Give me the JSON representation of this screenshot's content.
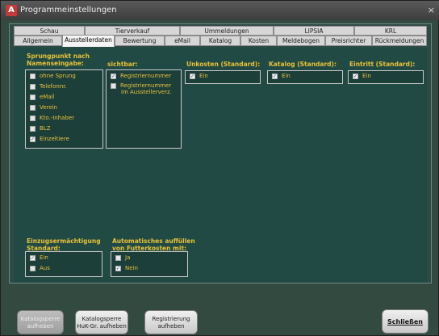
{
  "window": {
    "title": "Programmeinstellungen",
    "app_icon": "A",
    "close_glyph": "×"
  },
  "tabs_row1": [
    "Schau",
    "Tierverkauf",
    "Ummeldungen",
    "LIPSIA",
    "KRL"
  ],
  "tabs_row2": [
    "Allgemein",
    "Ausstellerdaten",
    "Bewertung",
    "eMail",
    "Katalog",
    "Kosten",
    "Meldebogen",
    "Preisrichter",
    "Rückmeldungen"
  ],
  "active_tab": "Ausstellerdaten",
  "sections": {
    "sprungpunkt": {
      "title_line1": "Sprungpunkt nach",
      "title_line2": "Namenseingabe:",
      "options": [
        {
          "label": "ohne Sprung",
          "checked": false
        },
        {
          "label": "Telefonnr.",
          "checked": false
        },
        {
          "label": "eMail",
          "checked": false
        },
        {
          "label": "Verein",
          "checked": false
        },
        {
          "label": "Kto.-Inhaber",
          "checked": false
        },
        {
          "label": "BLZ",
          "checked": false
        },
        {
          "label": "Einzeltiere",
          "checked": true
        }
      ]
    },
    "sichtbar": {
      "title": "sichtbar:",
      "options": [
        {
          "label": "Registriernummer",
          "checked": true
        },
        {
          "label_line1": "Registriernummer",
          "label_line2": "im Ausstellerverz.",
          "checked": false
        }
      ]
    },
    "unkosten": {
      "title": "Unkosten (Standard):",
      "option": {
        "label": "Ein",
        "checked": true
      }
    },
    "katalog": {
      "title": "Katalog (Standard):",
      "option": {
        "label": "Ein",
        "checked": true
      }
    },
    "eintritt": {
      "title": "Eintritt (Standard):",
      "option": {
        "label": "Ein",
        "checked": true
      }
    },
    "einzug": {
      "title_line1": "Einzugsermächtigung",
      "title_line2": "Standard:",
      "options": [
        {
          "label": "Ein",
          "checked": true
        },
        {
          "label": "Aus",
          "checked": false
        }
      ]
    },
    "futterkosten": {
      "title_line1": "Automatisches auffüllen",
      "title_line2": "von Futterkosten mit:",
      "options": [
        {
          "label": "Ja",
          "checked": false
        },
        {
          "label": "Nein",
          "checked": true
        }
      ]
    }
  },
  "buttons": {
    "katalogsperre_aufheben": {
      "line1": "Katalogsperre",
      "line2": "aufheben"
    },
    "katalogsperre_huk": {
      "line1": "Katalogsperre",
      "line2": "HuK-Gr. aufheben"
    },
    "registrierung": {
      "line1": "Registrierung",
      "line2": "aufheben"
    },
    "schliessen": "Schließen"
  },
  "check_glyph": "✓",
  "colors": {
    "label": "#e8c23a",
    "panel": "#214a44",
    "frame": "#334a40"
  }
}
